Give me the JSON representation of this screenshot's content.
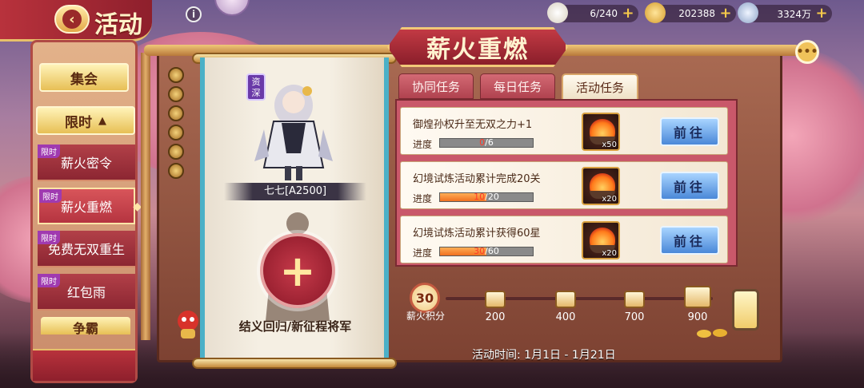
{
  "header": {
    "title": "活动"
  },
  "resources": [
    {
      "value": "6/240",
      "icon": "bun-icon",
      "color": "#f2efe6"
    },
    {
      "value": "202388",
      "icon": "gold-ingot-icon",
      "color": "#f6c94a"
    },
    {
      "value": "3324万",
      "icon": "silver-coin-icon",
      "color": "#b8c8e0"
    }
  ],
  "sidebar": {
    "top_button": "集会",
    "section": {
      "label": "限时",
      "arrow": "▲"
    },
    "items": [
      {
        "tag": "限时",
        "label": "薪火密令"
      },
      {
        "tag": "限时",
        "label": "薪火重燃",
        "active": true
      },
      {
        "tag": "限时",
        "label": "免费无双重生"
      },
      {
        "tag": "限时",
        "label": "红包雨"
      }
    ],
    "peek_label": "争霸"
  },
  "banner": {
    "title": "薪火重燃"
  },
  "tabs": [
    "协同任务",
    "每日任务",
    "活动任务"
  ],
  "active_tab": 2,
  "character": {
    "badge": "资深",
    "name": "七七[A2500]",
    "recruit_text": "结义回归/新征程将军"
  },
  "tasks": [
    {
      "title": "御煌孙权升至无双之力+1",
      "progress_label": "进度",
      "current": "0",
      "total": "/6",
      "fraction": 0.0,
      "reward_count": "x50",
      "button": "前往"
    },
    {
      "title": "幻境试炼活动累计完成20关",
      "progress_label": "进度",
      "current": "10",
      "total": "/20",
      "fraction": 0.5,
      "reward_count": "x20",
      "button": "前往"
    },
    {
      "title": "幻境试炼活动累计获得60星",
      "progress_label": "进度",
      "current": "30",
      "total": "/60",
      "fraction": 0.5,
      "reward_count": "x20",
      "button": "前往"
    }
  ],
  "points": {
    "value": "30",
    "label": "薪火积分",
    "milestones": [
      "200",
      "400",
      "700",
      "900"
    ]
  },
  "activity_time": "活动时间: 1月1日 - 1月21日",
  "colors": {
    "accent_red": "#b8323c",
    "gold": "#e7c06a",
    "button_blue": "#4a88d8",
    "progress_orange": "#f07020"
  }
}
